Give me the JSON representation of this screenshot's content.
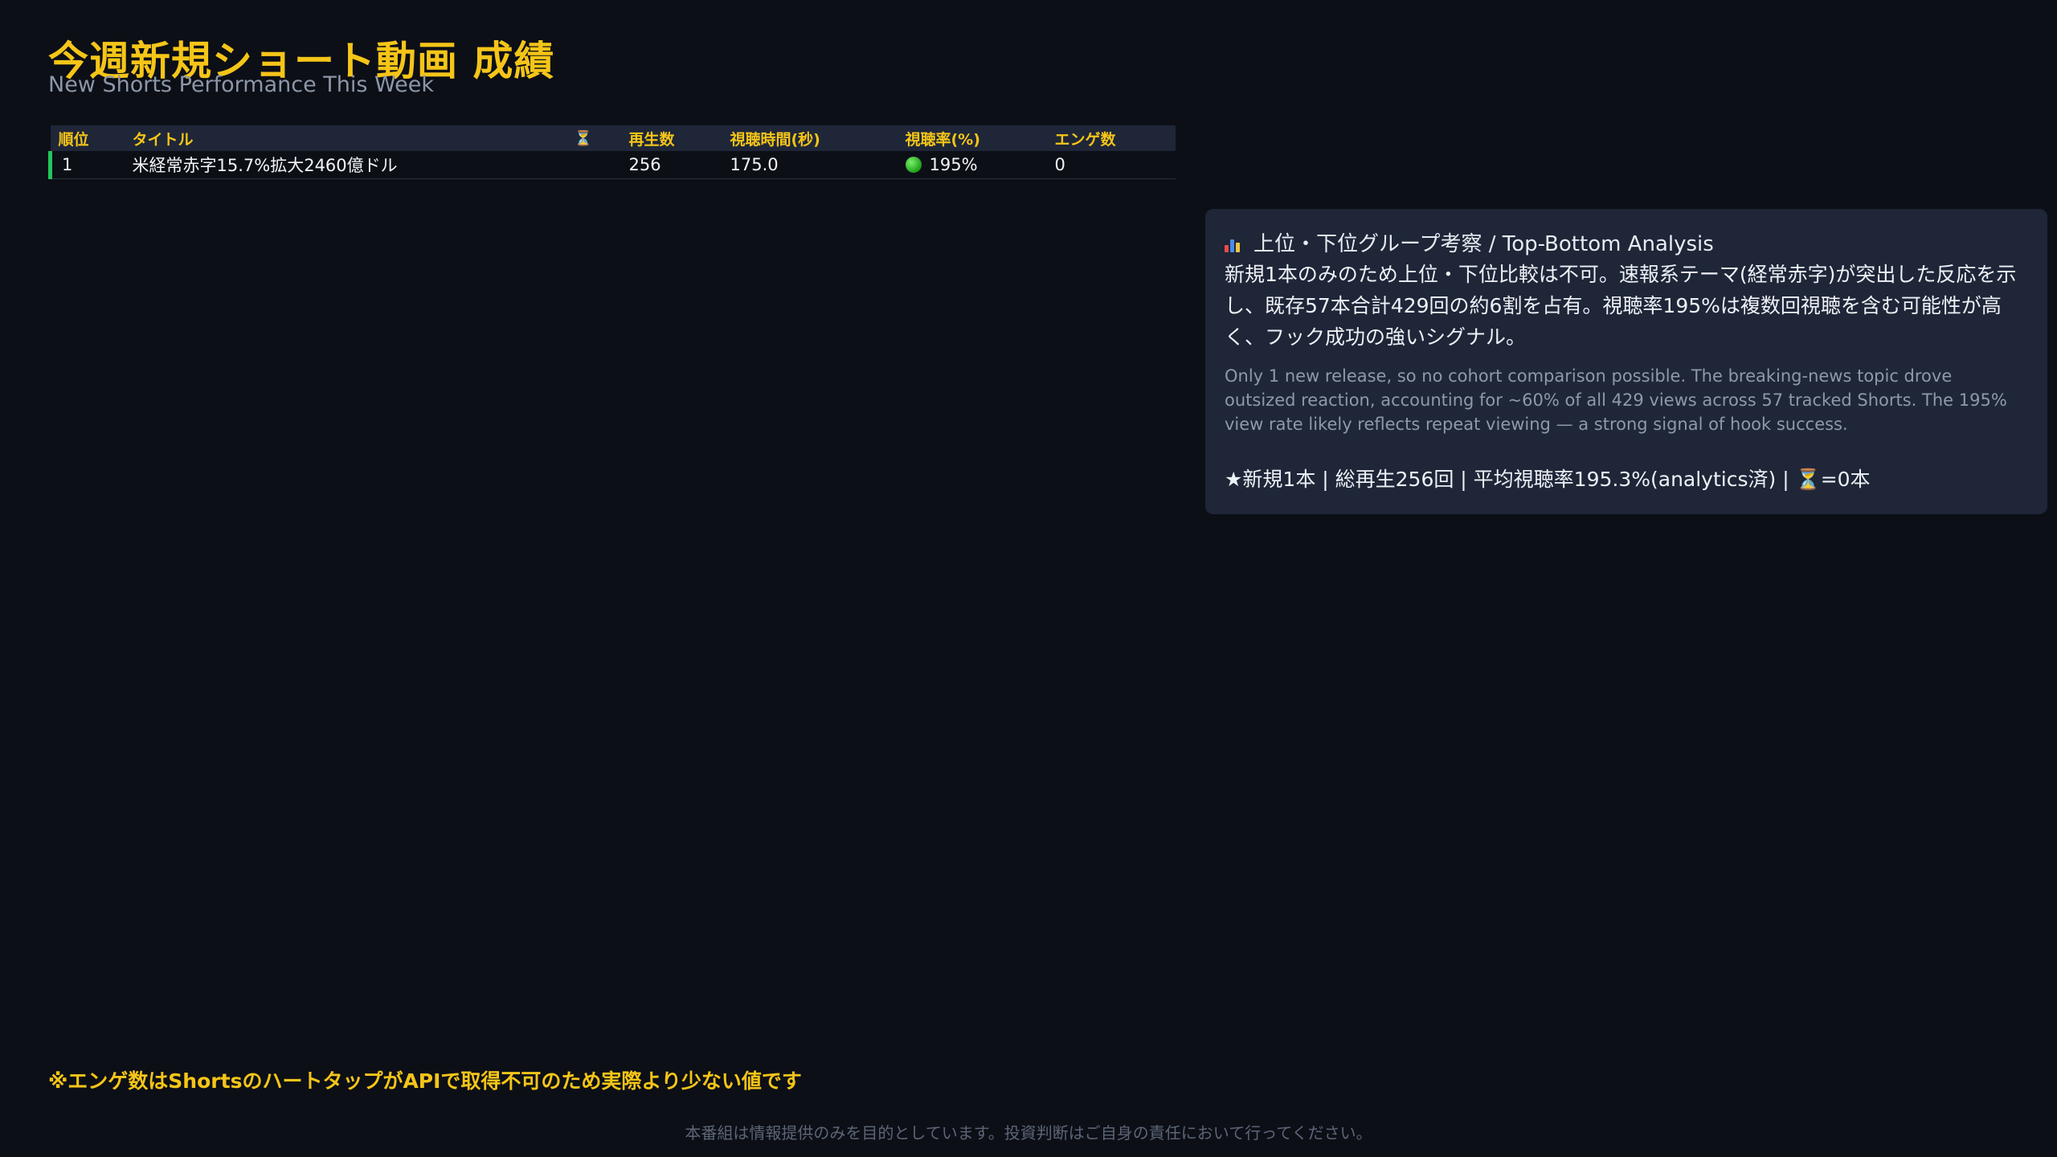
{
  "header": {
    "title": "今週新規ショート動画 成績",
    "subtitle": "New Shorts Performance This Week"
  },
  "table": {
    "columns": [
      "順位",
      "タイトル",
      "⏳",
      "再生数",
      "視聴時間(秒)",
      "視聴率(%)",
      "エンゲ数"
    ],
    "rows": [
      {
        "rank": "1",
        "title": "米経常赤字15.7%拡大2460億ドル",
        "pending": "",
        "views": "256",
        "watch_time": "175.0",
        "view_rate": "195%",
        "view_rate_status": "green",
        "engagements": "0"
      }
    ]
  },
  "analysis": {
    "heading_icon": "bar-chart-icon",
    "heading": "上位・下位グループ考察 / Top-Bottom Analysis",
    "body_ja": "新規1本のみのため上位・下位比較は不可。速報系テーマ(経常赤字)が突出した反応を示し、既存57本合計429回の約6割を占有。視聴率195%は複数回視聴を含む可能性が高く、フック成功の強いシグナル。",
    "body_en": "Only 1 new release, so no cohort comparison possible. The breaking-news topic drove outsized reaction, accounting for ~60% of all 429 views across 57 tracked Shorts. The 195% view rate likely reflects repeat viewing — a strong signal of hook success.",
    "summary": "★新規1本 | 総再生256回 | 平均視聴率195.3%(analytics済) | ⏳=0本"
  },
  "footer": {
    "note": "※エンゲ数はShortsのハートタップがAPIで取得不可のため実際より少ない値です",
    "disclaimer": "本番組は情報提供のみを目的としています。投資判断はご自身の責任において行ってください。"
  },
  "colors": {
    "background": "#0c0f16",
    "accent": "#f5c518",
    "panel": "#1e2638",
    "status_green": "#22c55e"
  }
}
